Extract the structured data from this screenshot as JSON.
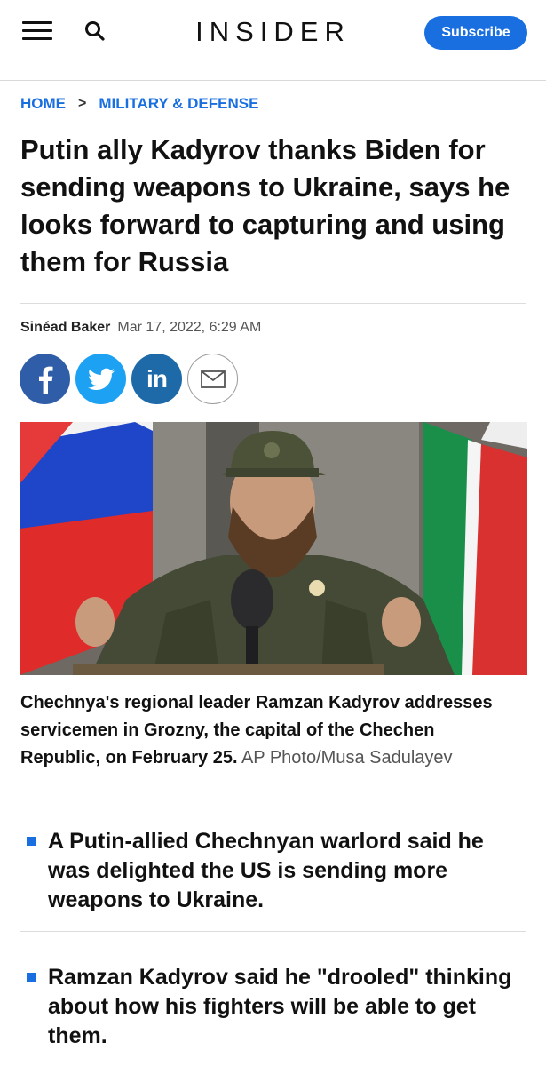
{
  "header": {
    "logo": "INSIDER",
    "subscribe_label": "Subscribe"
  },
  "breadcrumb": {
    "home": "HOME",
    "separator": ">",
    "section": "MILITARY & DEFENSE"
  },
  "article": {
    "headline": "Putin ally Kadyrov thanks Biden for sending weapons to Ukraine, says he looks forward to capturing and using them for Russia",
    "author": "Sinéad Baker",
    "date": "Mar 17, 2022, 6:29 AM",
    "share": [
      "facebook-icon",
      "twitter-icon",
      "linkedin-icon",
      "email-icon"
    ],
    "caption": "Chechnya's regional leader Ramzan Kadyrov addresses servicemen in Grozny, the capital of the Chechen Republic, on February 25.",
    "credit": "AP Photo/Musa Sadulayev",
    "bullets": [
      "A Putin-allied Chechnyan warlord said he was delighted the US is sending more weapons to Ukraine.",
      "Ramzan Kadyrov said he \"drooled\" thinking about how his fighters will be able to get them."
    ]
  },
  "colors": {
    "accent": "#1a6fe0",
    "facebook": "#2f5da8",
    "twitter": "#1da1f2",
    "linkedin": "#1e6aa9"
  }
}
